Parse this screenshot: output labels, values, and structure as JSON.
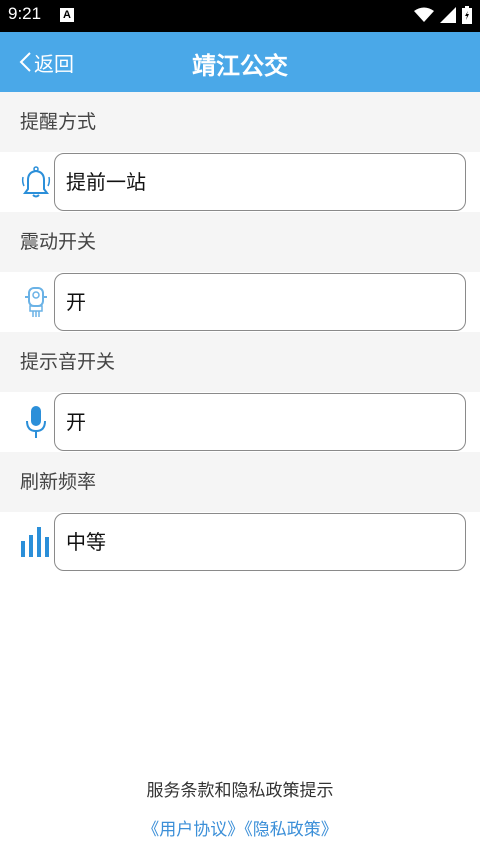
{
  "status_bar": {
    "time": "9:21",
    "notification_letter": "A"
  },
  "header": {
    "back_label": "返回",
    "title": "靖江公交"
  },
  "settings": [
    {
      "label": "提醒方式",
      "value": "提前一站",
      "icon": "bell-icon"
    },
    {
      "label": "震动开关",
      "value": "开",
      "icon": "vibration-icon"
    },
    {
      "label": "提示音开关",
      "value": "开",
      "icon": "microphone-icon"
    },
    {
      "label": "刷新频率",
      "value": "中等",
      "icon": "signal-bars-icon"
    }
  ],
  "footer": {
    "notice": "服务条款和隐私政策提示",
    "user_agreement": "《用户协议》",
    "privacy_policy": "《隐私政策》"
  },
  "colors": {
    "header_bg": "#4aa8e8",
    "icon_blue": "#2b8fd9",
    "link": "#3b8fd8",
    "section_bg": "#f5f5f5"
  }
}
